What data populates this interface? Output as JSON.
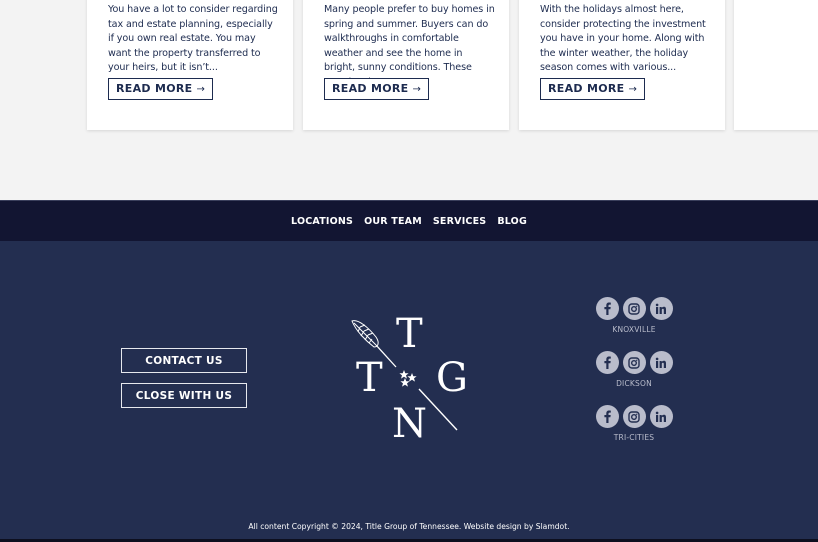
{
  "blog": {
    "cards": [
      {
        "excerpt": "You have a lot to consider regarding tax and estate planning, especially if you own real estate. You may want the property transferred to your heirs, but it isn’t...",
        "read_more": "READ MORE",
        "arrow": "→"
      },
      {
        "excerpt": "Many people prefer to buy homes in spring and summer. Buyers can do walkthroughs in comfortable weather and see the home in bright, sunny conditions. These months also...",
        "read_more": "READ MORE",
        "arrow": "→"
      },
      {
        "excerpt": "With the holidays almost here, consider protecting the investment you have in your home. Along with the winter weather, the holiday season comes with various...",
        "read_more": "READ MORE",
        "arrow": "→"
      }
    ]
  },
  "footer_nav": {
    "items": [
      "LOCATIONS",
      "OUR TEAM",
      "SERVICES",
      "BLOG"
    ]
  },
  "footer": {
    "contact_label": "CONTACT US",
    "close_label": "CLOSE WITH US",
    "logo": {
      "letters": [
        "T",
        "T",
        "G",
        "N"
      ],
      "icons": [
        "feather-quill",
        "three-stars"
      ]
    },
    "locations": [
      {
        "name": "KNOXVILLE",
        "icons": [
          "facebook-icon",
          "instagram-icon",
          "linkedin-icon"
        ]
      },
      {
        "name": "DICKSON",
        "icons": [
          "facebook-icon",
          "instagram-icon",
          "linkedin-icon"
        ]
      },
      {
        "name": "TRI-CITIES",
        "icons": [
          "facebook-icon",
          "instagram-icon",
          "linkedin-icon"
        ]
      }
    ],
    "copyright": "All content Copyright © 2024, Title Group of Tennessee. Website design by Slamdot."
  },
  "colors": {
    "navy_dark": "#121532",
    "navy": "#232e50",
    "text_navy": "#1d2b4f",
    "icon_gray": "#b9bccb",
    "page_bg": "#f3f3f3"
  }
}
